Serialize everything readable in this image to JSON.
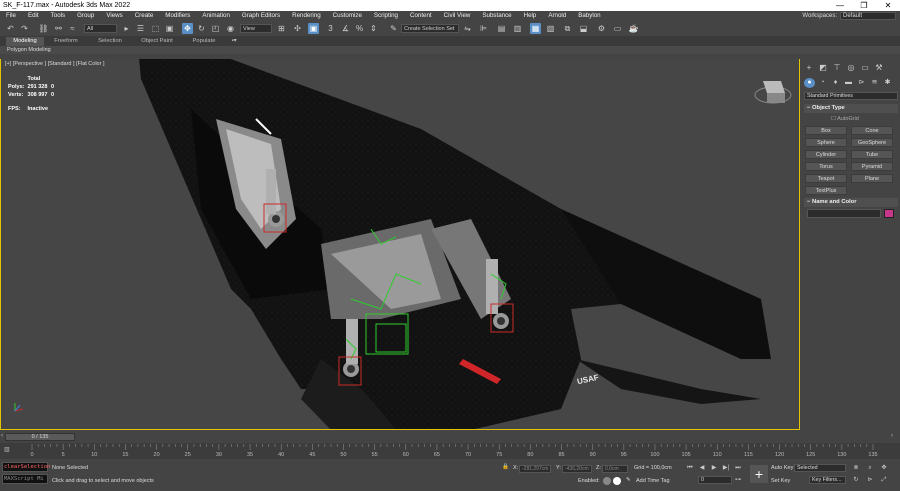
{
  "window": {
    "title": "SK_F-117.max - Autodesk 3ds Max 2022",
    "controls": [
      "—",
      "❐",
      "✕"
    ]
  },
  "menu": [
    "File",
    "Edit",
    "Tools",
    "Group",
    "Views",
    "Create",
    "Modifiers",
    "Animation",
    "Graph Editors",
    "Rendering",
    "Customize",
    "Scripting",
    "Content",
    "Civil View",
    "Substance",
    "Help",
    "Arnold",
    "Babylon"
  ],
  "workspaces": {
    "label": "Workspaces:",
    "value": "Default"
  },
  "toolbar": {
    "selection_filter": "All",
    "reference_coord": "View",
    "named_selection": "Create Selection Set"
  },
  "ribbon": {
    "tabs": [
      "Modeling",
      "Freeform",
      "Selection",
      "Object Paint",
      "Populate"
    ],
    "active_tab": "Modeling",
    "sub_label": "Polygon Modeling"
  },
  "viewport": {
    "label": "[+] [Perspective ] [Standard ] [Flat Color ]",
    "stats": {
      "header": "Total",
      "polys_label": "Polys:",
      "polys_total": "291 328",
      "polys_sel": "0",
      "verts_label": "Verts:",
      "verts_total": "308 997",
      "verts_sel": "0",
      "fps_label": "FPS:",
      "fps_value": "Inactive"
    },
    "fuselage_text": "USAF"
  },
  "command_panel": {
    "category": "Standard Primitives",
    "object_type_title": "Object Type",
    "autogrid_label": "AutoGrid",
    "buttons": [
      "Box",
      "Cone",
      "Sphere",
      "GeoSphere",
      "Cylinder",
      "Tube",
      "Torus",
      "Pyramid",
      "Teapot",
      "Plane",
      "TextPlus"
    ],
    "name_color_title": "Name and Color",
    "color": "#c8368c"
  },
  "time_slider": {
    "value": "0 / 135"
  },
  "trackbar": {
    "ticks": [
      "0",
      "5",
      "10",
      "15",
      "20",
      "25",
      "30",
      "35",
      "40",
      "45",
      "50",
      "55",
      "60",
      "65",
      "70",
      "75",
      "80",
      "85",
      "90",
      "95",
      "100",
      "105",
      "110",
      "115",
      "120",
      "125",
      "130",
      "135"
    ]
  },
  "status": {
    "maxscript_top": "clearSelection",
    "maxscript_bottom": "MAXScript Mi",
    "selection": "None Selected",
    "prompt": "Click and drag to select and move objects",
    "x_label": "X:",
    "x_value": "-281,297cm",
    "y_label": "Y:",
    "y_value": "-436,20cm",
    "z_label": "Z:",
    "z_value": "0,0cm",
    "grid": "Grid = 100,0cm",
    "enabled_label": "Enabled:",
    "add_time_tag": "Add Time Tag",
    "auto_key": "Auto Key",
    "auto_key_mode": "Selected",
    "set_key": "Set Key",
    "key_filters": "Key Filters...",
    "frame": "0"
  }
}
